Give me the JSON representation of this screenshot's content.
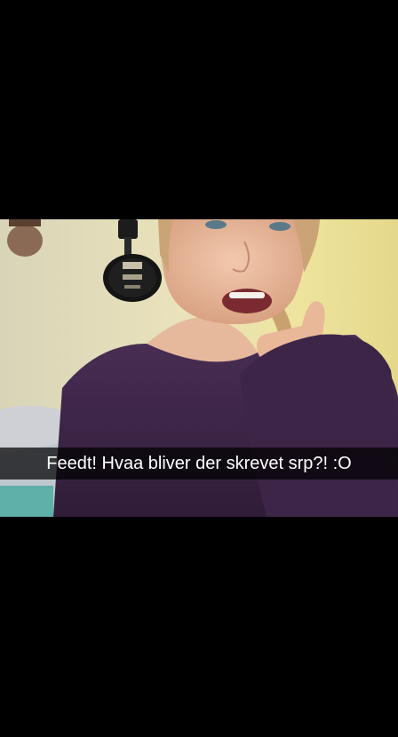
{
  "snap": {
    "caption": "Feedt! Hvaa bliver der skrevet srp?! :O"
  },
  "colors": {
    "background": "#000000",
    "caption_bar": "#000000b8",
    "caption_text": "#ffffff",
    "sweater": "#3b2545",
    "wall": "#e6dfb7"
  }
}
